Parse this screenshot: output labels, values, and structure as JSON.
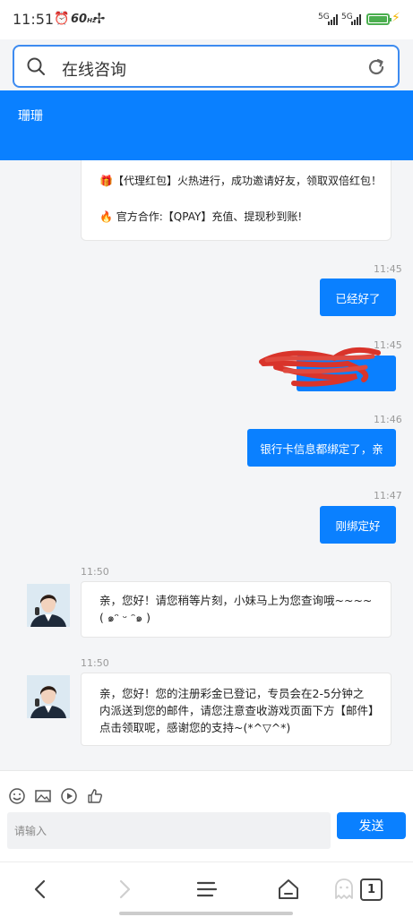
{
  "status_bar": {
    "time": "11:51",
    "refresh_rate": "60",
    "refresh_unit": "Hz",
    "signal_1": "5G",
    "signal_2": "5G",
    "battery_color": "#4caf50"
  },
  "search": {
    "value": "在线咨询",
    "icons": [
      "search-icon",
      "refresh-icon"
    ]
  },
  "header": {
    "title": "珊珊",
    "color": "#0a80ff"
  },
  "notice": {
    "line1": "🎁【代理红包】火热进行，成功邀请好友，领取双倍红包！",
    "line2": "🔥 官方合作:【QPAY】充值、提现秒到账!"
  },
  "messages": [
    {
      "from": "me",
      "time": "11:45",
      "text": "已经好了"
    },
    {
      "from": "me",
      "time": "11:45",
      "text": ""
    },
    {
      "from": "me",
      "time": "11:46",
      "text": "银行卡信息都绑定了，亲"
    },
    {
      "from": "me",
      "time": "11:47",
      "text": "刚绑定好"
    },
    {
      "from": "them",
      "time": "11:50",
      "text": "亲，您好！请您稍等片刻，小妹马上为您查询哦~~~~( ๑ᵔ ᵕ ᵔ๑ )"
    },
    {
      "from": "them",
      "time": "11:50",
      "text": "亲，您好！您的注册彩金已登记，专员会在2-5分钟之内派送到您的邮件，请您注意查收游戏页面下方【邮件】点击领取呢，感谢您的支持~(*^▽^*)"
    }
  ],
  "composer": {
    "placeholder": "请输入",
    "send_label": "发送",
    "tools": [
      "emoji-icon",
      "image-icon",
      "video-icon",
      "thumbs-up-icon"
    ]
  },
  "browser_nav": {
    "tab_count": "1",
    "icons": [
      "back-icon",
      "forward-icon",
      "menu-icon",
      "home-icon",
      "ghost-icon",
      "tabs-icon"
    ]
  }
}
